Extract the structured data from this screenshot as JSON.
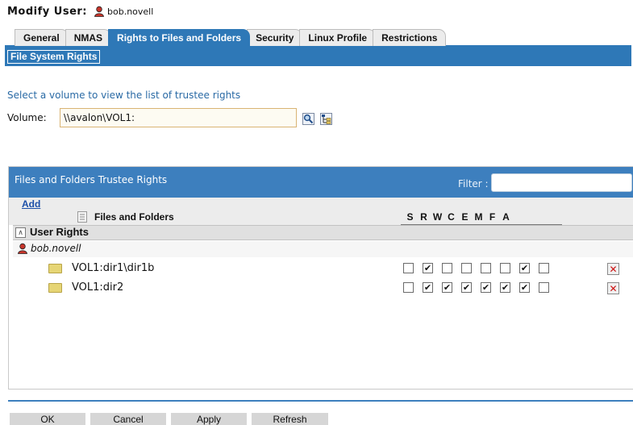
{
  "header": {
    "title": "Modify User:",
    "user": "bob.novell"
  },
  "tabs": [
    {
      "label": "General",
      "active": false
    },
    {
      "label": "NMAS",
      "active": false
    },
    {
      "label": "Rights to Files and Folders",
      "active": true
    },
    {
      "label": "Security",
      "active": false
    },
    {
      "label": "Linux Profile",
      "active": false
    },
    {
      "label": "Restrictions",
      "active": false
    }
  ],
  "section_label": "File System Rights",
  "volume": {
    "hint": "Select a volume to view the list of trustee rights",
    "label": "Volume:",
    "value": "\\\\avalon\\VOL1:",
    "search_icon": "magnifier-icon",
    "browse_icon": "tree-browse-icon"
  },
  "trustees": {
    "title": "Files and Folders Trustee Rights",
    "filter_label": "Filter :",
    "filter_value": "",
    "add_label": "Add",
    "files_column": "Files and Folders",
    "rights_columns": [
      "S",
      "R",
      "W",
      "C",
      "E",
      "M",
      "F",
      "A"
    ],
    "group_label": "User Rights",
    "owner": "bob.novell",
    "rows": [
      {
        "path": "VOL1:dir1\\dir1b",
        "rights": [
          false,
          true,
          false,
          false,
          false,
          false,
          true,
          false
        ]
      },
      {
        "path": "VOL1:dir2",
        "rights": [
          false,
          true,
          true,
          true,
          true,
          true,
          true,
          false
        ]
      }
    ]
  },
  "buttons": {
    "ok": "OK",
    "cancel": "Cancel",
    "apply": "Apply",
    "refresh": "Refresh"
  },
  "colors": {
    "accent": "#2e78b7",
    "panel_header": "#3d7fbe",
    "delete": "#cc1010"
  }
}
